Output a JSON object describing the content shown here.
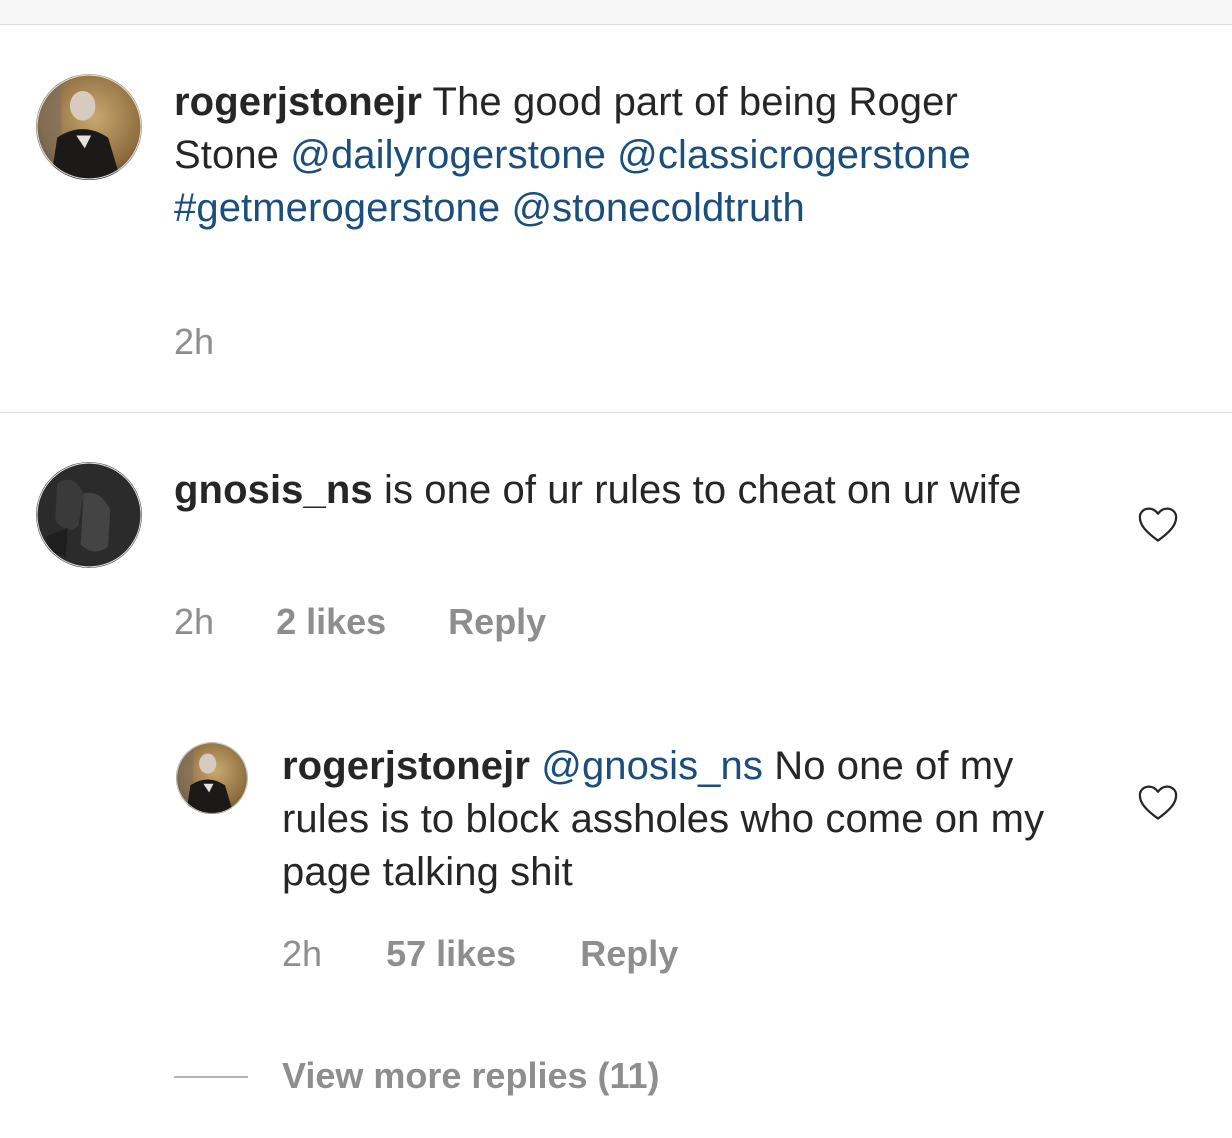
{
  "caption": {
    "username": "rogerjstonejr",
    "text": "The good part of being Roger Stone",
    "mention_1": "@dailyrogerstone",
    "mention_2": "@classicrogerstone",
    "hashtag": "#getmerogerstone",
    "mention_3": "@stonecoldtruth",
    "time": "2h",
    "avatar_icon": "profile-photo-icon"
  },
  "comments": [
    {
      "username": "gnosis_ns",
      "text": "is one of ur rules to cheat on ur wife",
      "time": "2h",
      "likes": "2 likes",
      "reply_label": "Reply",
      "like_icon": "heart-icon",
      "avatar_icon": "profile-photo-icon"
    },
    {
      "username": "rogerjstonejr",
      "mention": "@gnosis_ns",
      "text": "No one of my rules is to block assholes who come on my page talking shit",
      "time": "2h",
      "likes": "57 likes",
      "reply_label": "Reply",
      "like_icon": "heart-icon",
      "avatar_icon": "profile-photo-icon"
    }
  ],
  "view_more_replies": "View more replies (11)",
  "colors": {
    "text": "#262626",
    "link": "#1b4e7d",
    "meta": "#8e8e8e",
    "divider": "#dbdbdb"
  }
}
